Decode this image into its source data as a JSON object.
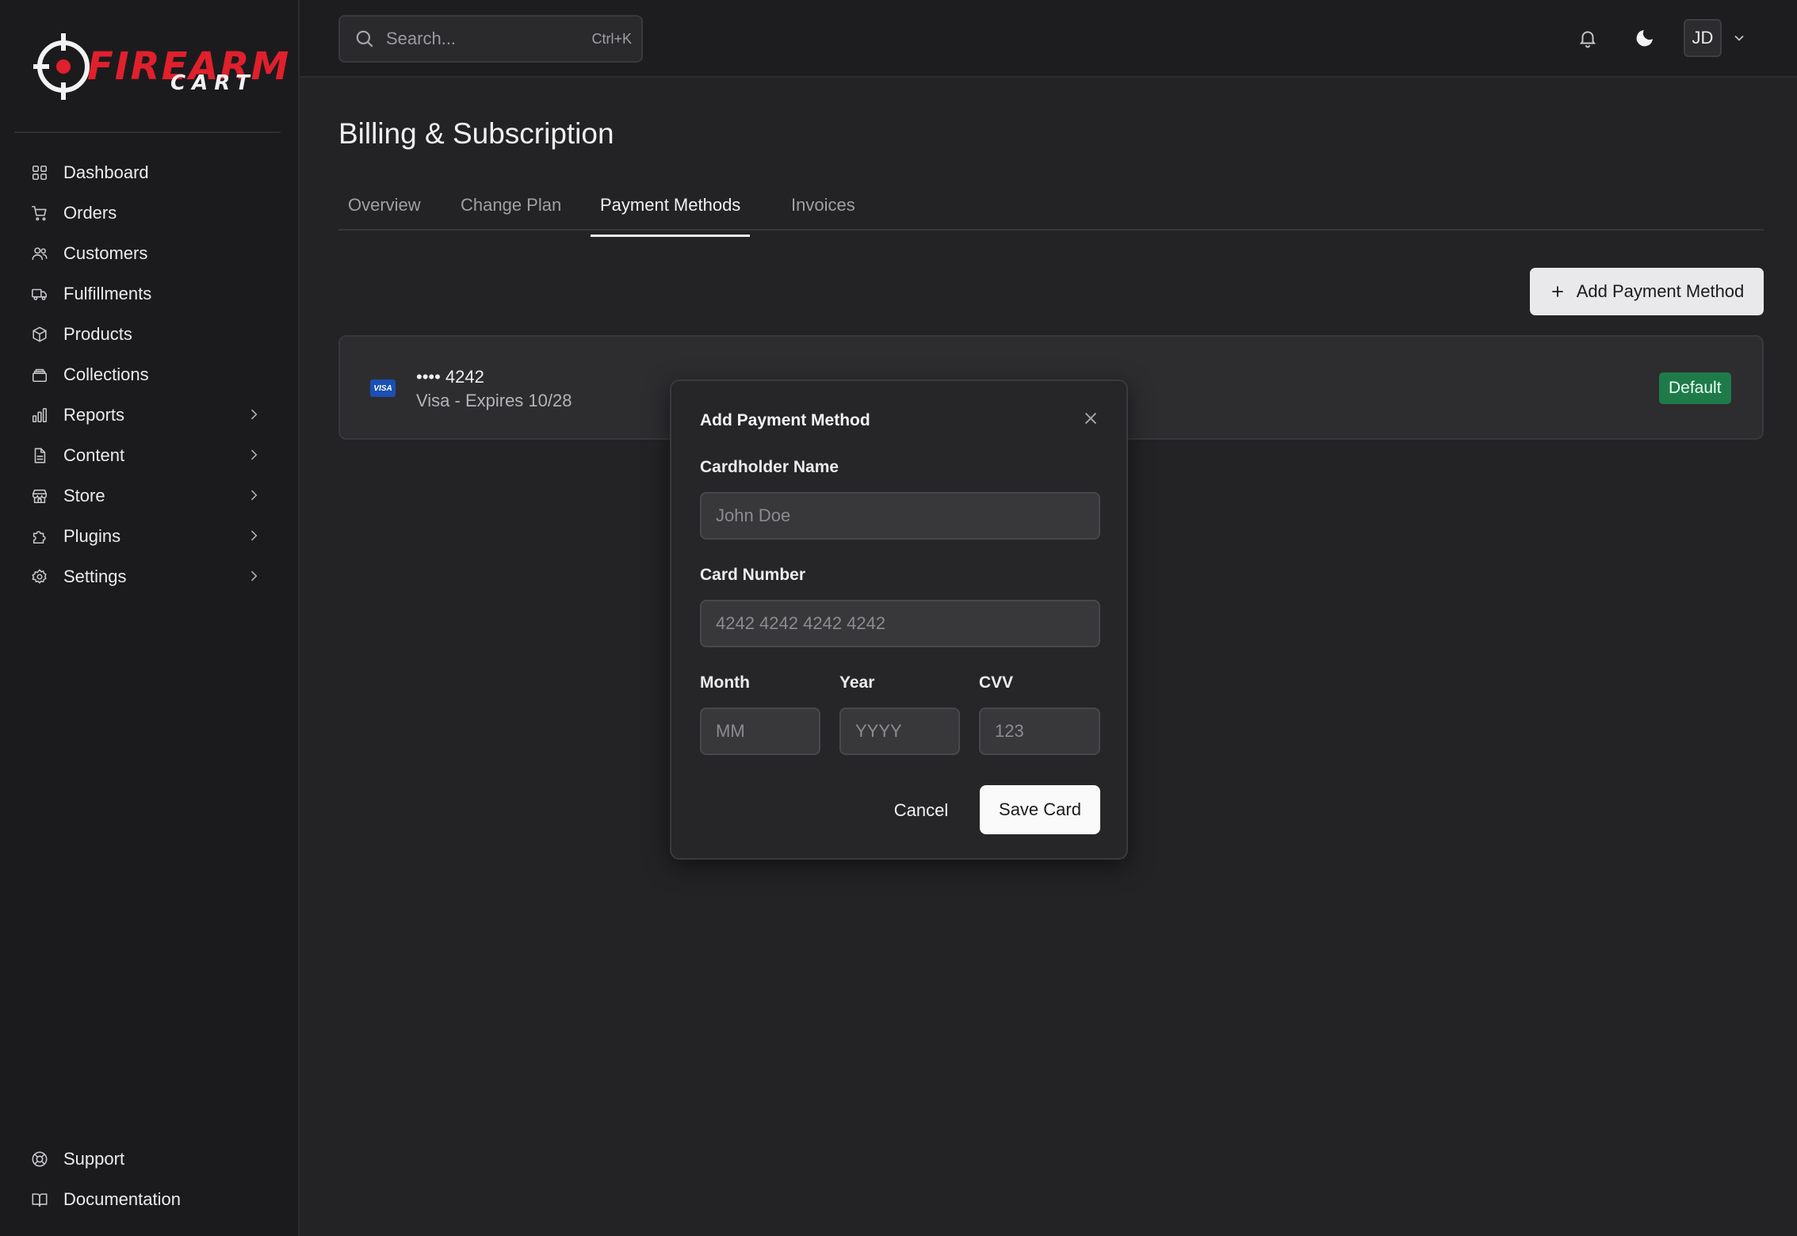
{
  "brand": {
    "name_main": "FIREARM",
    "name_sub": "CART",
    "accent": "#e0202c"
  },
  "sidebar": {
    "items": [
      {
        "label": "Dashboard",
        "icon": "dashboard-icon",
        "has_children": false
      },
      {
        "label": "Orders",
        "icon": "cart-icon",
        "has_children": false
      },
      {
        "label": "Customers",
        "icon": "users-icon",
        "has_children": false
      },
      {
        "label": "Fulfillments",
        "icon": "truck-icon",
        "has_children": false
      },
      {
        "label": "Products",
        "icon": "box-icon",
        "has_children": false
      },
      {
        "label": "Collections",
        "icon": "stack-icon",
        "has_children": false
      },
      {
        "label": "Reports",
        "icon": "bar-chart-icon",
        "has_children": true
      },
      {
        "label": "Content",
        "icon": "document-icon",
        "has_children": true
      },
      {
        "label": "Store",
        "icon": "store-icon",
        "has_children": true
      },
      {
        "label": "Plugins",
        "icon": "puzzle-icon",
        "has_children": true
      },
      {
        "label": "Settings",
        "icon": "gear-icon",
        "has_children": true
      }
    ],
    "bottom_items": [
      {
        "label": "Support",
        "icon": "lifebuoy-icon"
      },
      {
        "label": "Documentation",
        "icon": "book-icon"
      }
    ]
  },
  "topbar": {
    "search_placeholder": "Search...",
    "search_shortcut": "Ctrl+K",
    "avatar_initials": "JD"
  },
  "main": {
    "title": "Billing & Subscription",
    "tabs": [
      {
        "label": "Overview",
        "active": false
      },
      {
        "label": "Change Plan",
        "active": false
      },
      {
        "label": "Payment Methods",
        "active": true
      },
      {
        "label": "Invoices",
        "active": false
      }
    ],
    "add_button_label": "Add Payment Method",
    "payment_methods": [
      {
        "brand": "VISA",
        "number": "•••• 4242",
        "details": "Visa - Expires 10/28",
        "badge": "Default",
        "badge_color": "#1f7a4a"
      }
    ]
  },
  "modal": {
    "title": "Add Payment Method",
    "cardholder_label": "Cardholder Name",
    "cardholder_placeholder": "John Doe",
    "card_number_label": "Card Number",
    "card_number_placeholder": "4242 4242 4242 4242",
    "month_label": "Month",
    "month_placeholder": "MM",
    "year_label": "Year",
    "year_placeholder": "YYYY",
    "cvv_label": "CVV",
    "cvv_placeholder": "123",
    "cancel_label": "Cancel",
    "save_label": "Save Card"
  }
}
